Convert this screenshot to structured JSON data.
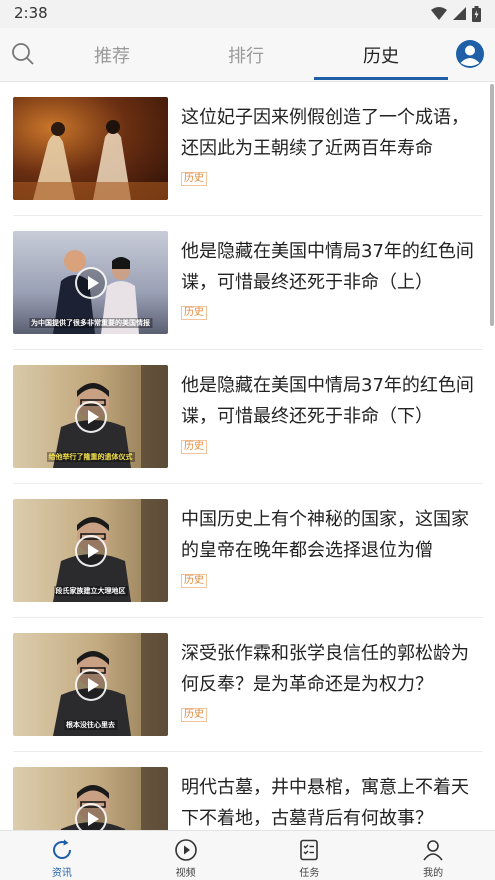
{
  "status_bar": {
    "time": "2:38"
  },
  "header": {
    "tabs": [
      {
        "label": "推荐"
      },
      {
        "label": "排行"
      },
      {
        "label": "历史"
      }
    ],
    "active_tab": "历史",
    "accent_color": "#1f5fa8"
  },
  "feed": {
    "items": [
      {
        "title": "这位妃子因来例假创造了一个成语，还因此为王朝续了近两百年寿命",
        "tag": "历史",
        "thumb_caption": "",
        "has_play": false
      },
      {
        "title": "他是隐藏在美国中情局37年的红色间谍，可惜最终还死于非命（上）",
        "tag": "历史",
        "thumb_caption": "为中国提供了很多非常重要的美国情报",
        "has_play": true
      },
      {
        "title": "他是隐藏在美国中情局37年的红色间谍，可惜最终还死于非命（下）",
        "tag": "历史",
        "thumb_caption": "给他举行了隆重的遗体仪式",
        "has_play": true
      },
      {
        "title": "中国历史上有个神秘的国家，这国家的皇帝在晚年都会选择退位为僧",
        "tag": "历史",
        "thumb_caption": "段氏家族建立大理地区",
        "has_play": true
      },
      {
        "title": "深受张作霖和张学良信任的郭松龄为何反奉？是为革命还是为权力？",
        "tag": "历史",
        "thumb_caption": "根本没往心里去",
        "has_play": true
      },
      {
        "title": "明代古墓，井中悬棺，寓意上不着天下不着地，古墓背后有何故事？",
        "tag": "历史",
        "thumb_caption": "",
        "has_play": true
      }
    ]
  },
  "bottom_nav": {
    "items": [
      {
        "label": "资讯",
        "icon": "refresh-icon"
      },
      {
        "label": "视频",
        "icon": "play-circle-icon"
      },
      {
        "label": "任务",
        "icon": "checklist-icon"
      },
      {
        "label": "我的",
        "icon": "person-icon"
      }
    ],
    "active": "资讯"
  }
}
